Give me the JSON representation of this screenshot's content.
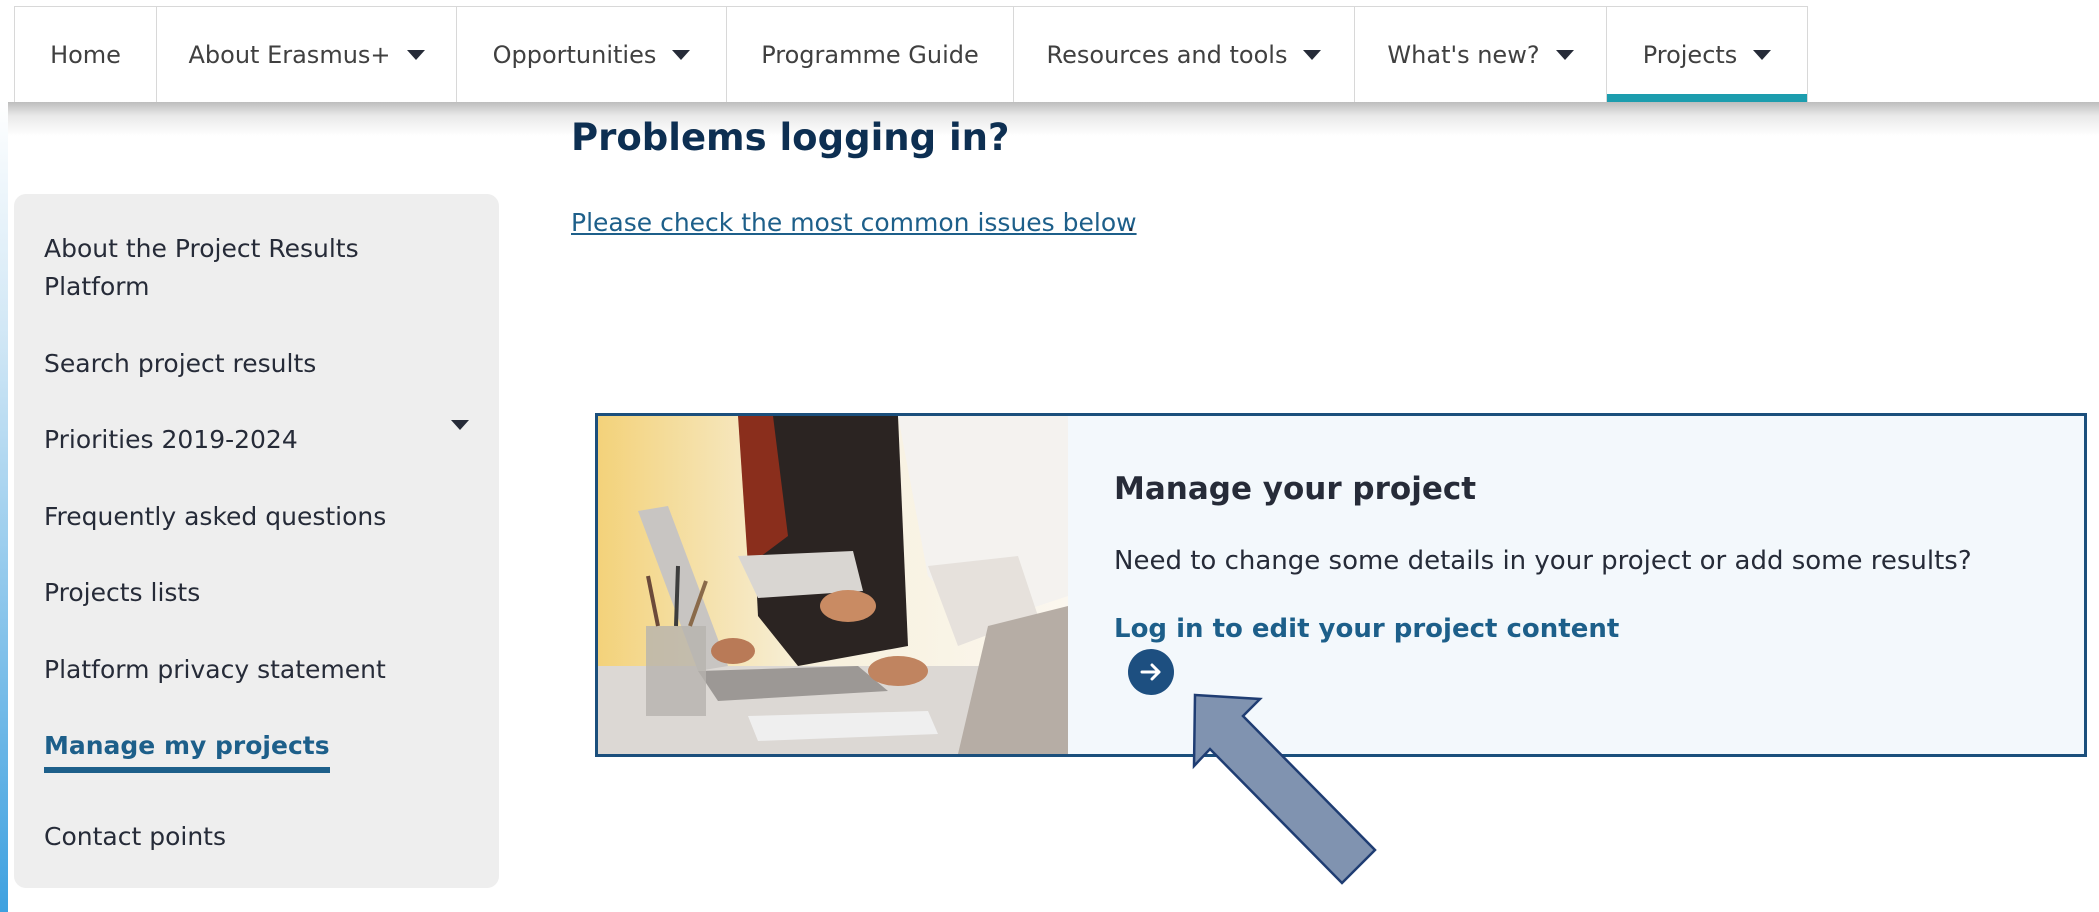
{
  "nav": {
    "items": [
      {
        "label": "Home",
        "dropdown": false,
        "active": false
      },
      {
        "label": "About Erasmus+",
        "dropdown": true,
        "active": false
      },
      {
        "label": "Opportunities",
        "dropdown": true,
        "active": false
      },
      {
        "label": "Programme Guide",
        "dropdown": false,
        "active": false
      },
      {
        "label": "Resources and tools",
        "dropdown": true,
        "active": false
      },
      {
        "label": "What's new?",
        "dropdown": true,
        "active": false
      },
      {
        "label": "Projects",
        "dropdown": true,
        "active": true
      }
    ],
    "active_color": "#1c9dae"
  },
  "sidebar": {
    "items": [
      {
        "label": "About the Project Results Platform"
      },
      {
        "label": "Search project results"
      },
      {
        "label": "Priorities 2019-2024"
      },
      {
        "label": "Frequently asked questions"
      },
      {
        "label": "Projects lists"
      },
      {
        "label": "Platform privacy statement"
      },
      {
        "label": "Manage my projects"
      },
      {
        "label": "Contact points"
      }
    ]
  },
  "main": {
    "title": "Problems logging in?",
    "check_link": "Please check the most common issues below",
    "check_suffix": "."
  },
  "card": {
    "title": "Manage your project",
    "description": "Need to change some details in your project or add some results?",
    "link": "Log in to edit your project content"
  },
  "colors": {
    "brand_dark": "#0d2f52",
    "link": "#1d5f8a",
    "card_border": "#1b4f7c",
    "annotation_arrow": "#8093b0"
  }
}
